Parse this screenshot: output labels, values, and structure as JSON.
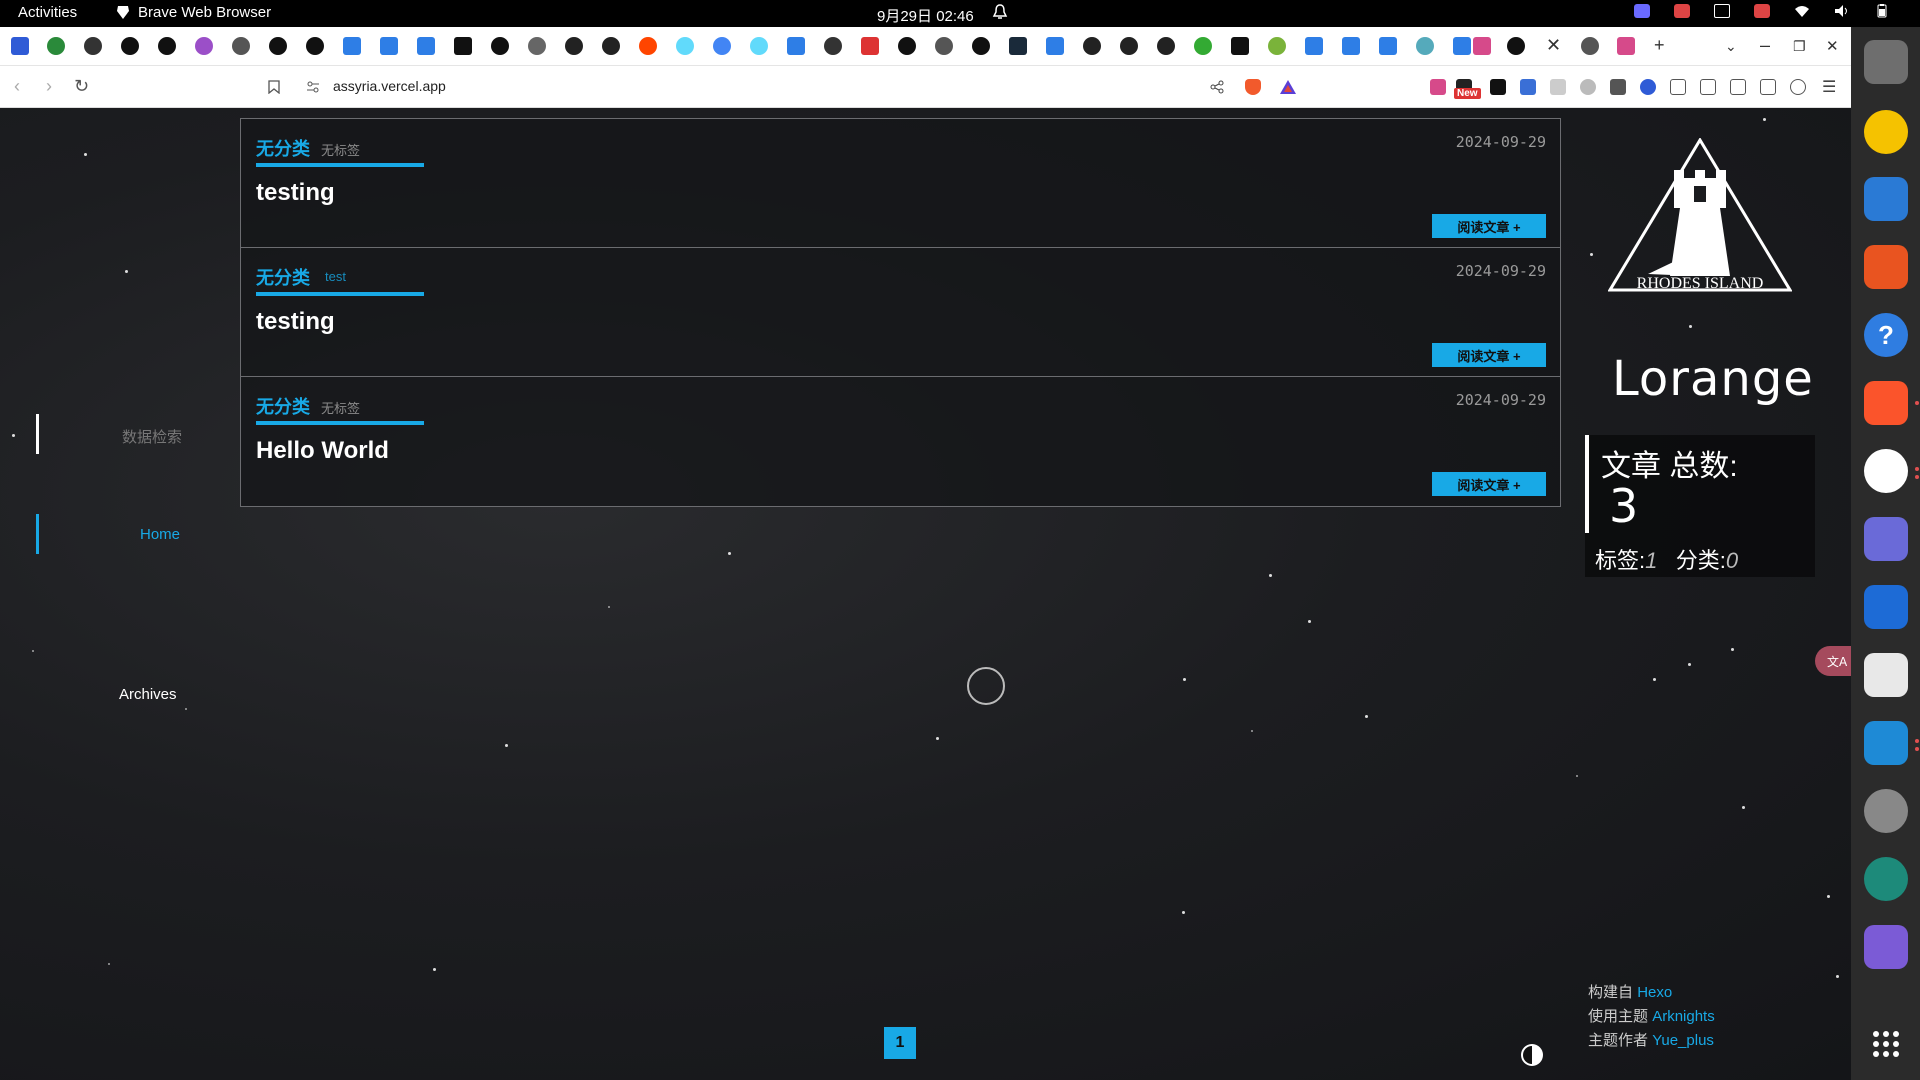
{
  "system_bar": {
    "activities": "Activities",
    "app_name": "Brave Web Browser",
    "clock": "9月29日  02:46"
  },
  "browser": {
    "url": "assyria.vercel.app",
    "extension_badge": "New"
  },
  "site": {
    "nav": {
      "search": "数据检索",
      "home": "Home",
      "archives": "Archives"
    },
    "posts": [
      {
        "category": "无分类",
        "tag": "无标签",
        "date": "2024-09-29",
        "title": "testing",
        "read_more": "阅读文章 +"
      },
      {
        "category": "无分类",
        "tag": "test",
        "date": "2024-09-29",
        "title": "testing",
        "read_more": "阅读文章 +"
      },
      {
        "category": "无分类",
        "tag": "无标签",
        "date": "2024-09-29",
        "title": "Hello World",
        "read_more": "阅读文章 +"
      }
    ],
    "logo_text": "RHODES ISLAND",
    "author": "Lorange",
    "stats": {
      "posts_label": "文章 总数:",
      "posts_count": "3",
      "tags_label": "标签:",
      "tags_count": "1",
      "categories_label": "分类:",
      "categories_count": "0"
    },
    "footer": {
      "built_label": "构建自",
      "built_link": "Hexo",
      "theme_label": "使用主题",
      "theme_link": "Arknights",
      "author_label": "主题作者",
      "author_link": "Yue_plus"
    },
    "current_page": "1"
  },
  "colors": {
    "accent": "#18a9e6",
    "background": "#17181b",
    "border": "#6b6c70"
  }
}
